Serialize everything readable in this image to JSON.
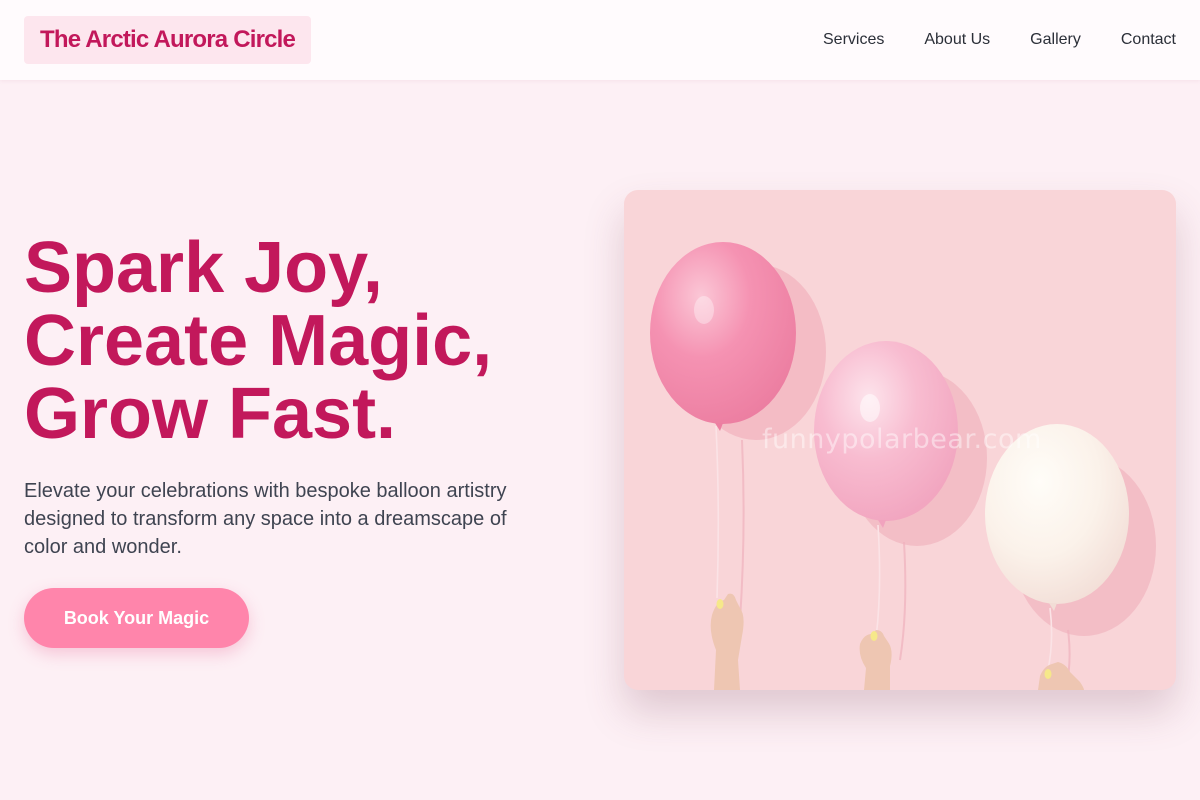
{
  "brand": {
    "name": "The Arctic Aurora Circle"
  },
  "nav": {
    "items": [
      {
        "label": "Services"
      },
      {
        "label": "About Us"
      },
      {
        "label": "Gallery"
      },
      {
        "label": "Contact"
      }
    ]
  },
  "hero": {
    "headline_lines": [
      "Spark Joy,",
      "Create Magic,",
      "Grow Fast."
    ],
    "subtext": "Elevate your celebrations with bespoke balloon artistry designed to transform any space into a dreamscape of color and wonder.",
    "cta_label": "Book Your Magic",
    "image": {
      "subject": "three balloons held by hands",
      "watermark": "funnypolarbear.com"
    }
  },
  "colors": {
    "page_background": "#fdf0f5",
    "header_background": "#fffbfd",
    "brand_accent": "#c2185b",
    "cta_background": "#ff85ab",
    "body_text": "#3f4451",
    "nav_text": "#2b2f38",
    "image_background": "#f9d5d8"
  }
}
